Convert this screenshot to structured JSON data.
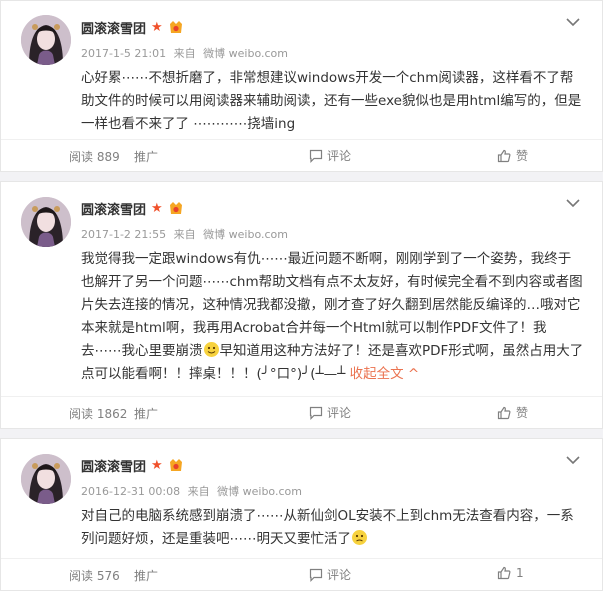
{
  "posts": [
    {
      "author": "圆滚滚雪团",
      "time": "2017-1-5 21:01",
      "source_prefix": "来自",
      "source": "微博 weibo.com",
      "text": "心好累⋯⋯不想折磨了，非常想建议windows开发一个chm阅读器，这样看不了帮助文件的时候可以用阅读器来辅助阅读，还有一些exe貌似也是用html编写的，但是一样也看不来了了 ⋯⋯⋯⋯挠墙ing",
      "actions": {
        "read": "阅读 889",
        "promote": "推广",
        "comment": "评论",
        "like": "赞"
      }
    },
    {
      "author": "圆滚滚雪团",
      "time": "2017-1-2 21:55",
      "source_prefix": "来自",
      "source": "微博 weibo.com",
      "text_before_emoji": "我觉得我一定跟windows有仇⋯⋯最近问题不断啊，刚刚学到了一个姿势，我终于也解开了另一个问题⋯⋯chm帮助文档有点不太友好，有时候完全看不到内容或者图片失去连接的情况，这种情况我都没撤，刚才查了好久翻到居然能反编译的…哦对它本来就是html啊，我再用Acrobat合并每一个Html就可以制作PDF文件了！我去⋯⋯我心里要崩溃",
      "text_after_emoji": "早知道用这种方法好了！还是喜欢PDF形式啊，虽然占用大了点可以能看啊！！摔桌！！！(╯°口°)╯(┴—┴ ",
      "collapse_label": "收起全文 ^",
      "actions": {
        "read": "阅读 1862",
        "promote": "推广",
        "comment": "评论",
        "like": "赞"
      }
    },
    {
      "author": "圆滚滚雪团",
      "time": "2016-12-31 00:08",
      "source_prefix": "来自",
      "source": "微博 weibo.com",
      "text": "对自己的电脑系统感到崩溃了⋯⋯从新仙剑OL安装不上到chm无法查看内容，一系列问题好烦，还是重装吧⋯⋯明天又要忙活了",
      "actions": {
        "read": "阅读 576",
        "promote": "推广",
        "comment": "评论",
        "like": "1"
      }
    }
  ],
  "colors": {
    "link": "#eb7350",
    "muted": "#808080",
    "star": "#f0512b"
  },
  "icons": [
    "avatar",
    "star-icon",
    "vip-icon",
    "chevron-down-icon",
    "comment-icon",
    "like-icon",
    "emoji-icon"
  ]
}
